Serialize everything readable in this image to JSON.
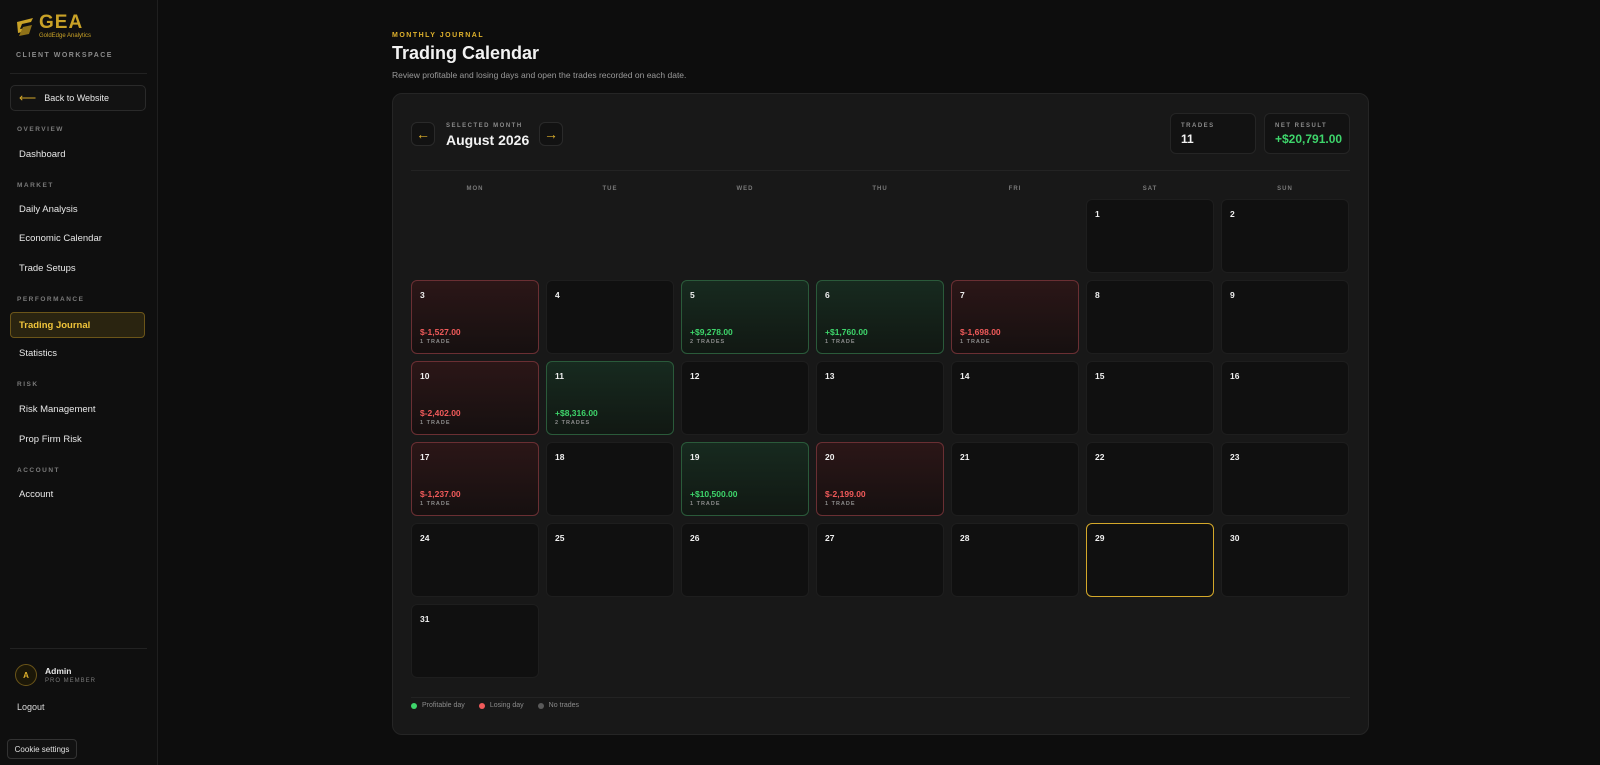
{
  "brand": {
    "name": "GEA",
    "tagline": "GoldEdge Analytics",
    "workspace": "CLIENT WORKSPACE"
  },
  "sidebar": {
    "back_label": "Back to Website",
    "sections": [
      {
        "title": "OVERVIEW",
        "items": [
          "Dashboard"
        ]
      },
      {
        "title": "MARKET",
        "items": [
          "Daily Analysis",
          "Economic Calendar",
          "Trade Setups"
        ]
      },
      {
        "title": "PERFORMANCE",
        "items": [
          "Trading Journal",
          "Statistics"
        ]
      },
      {
        "title": "RISK",
        "items": [
          "Risk Management",
          "Prop Firm Risk"
        ]
      },
      {
        "title": "ACCOUNT",
        "items": [
          "Account"
        ]
      }
    ],
    "active_item": "Trading Journal",
    "user": {
      "initial": "A",
      "name": "Admin",
      "role": "PRO MEMBER"
    },
    "logout_label": "Logout",
    "cookie_label": "Cookie settings"
  },
  "header": {
    "eyebrow": "MONTHLY JOURNAL",
    "title": "Trading Calendar",
    "subtitle": "Review profitable and losing days and open the trades recorded on each date."
  },
  "calendar": {
    "selected_label": "SELECTED MONTH",
    "month": "August 2026",
    "prev_icon": "←",
    "next_icon": "→",
    "stats": {
      "trades_label": "TRADES",
      "trades_value": "11",
      "net_label": "NET RESULT",
      "net_value": "+$20,791.00"
    },
    "weekdays": [
      "MON",
      "TUE",
      "WED",
      "THU",
      "FRI",
      "SAT",
      "SUN"
    ],
    "days": [
      {
        "day": "1",
        "col": 5,
        "row": 0
      },
      {
        "day": "2",
        "col": 6,
        "row": 0
      },
      {
        "day": "3",
        "col": 0,
        "row": 1,
        "status": "loss",
        "pnl": "$-1,527.00",
        "trades": "1 TRADE"
      },
      {
        "day": "4",
        "col": 1,
        "row": 1
      },
      {
        "day": "5",
        "col": 2,
        "row": 1,
        "status": "win",
        "pnl": "+$9,278.00",
        "trades": "2 TRADES"
      },
      {
        "day": "6",
        "col": 3,
        "row": 1,
        "status": "win",
        "pnl": "+$1,760.00",
        "trades": "1 TRADE"
      },
      {
        "day": "7",
        "col": 4,
        "row": 1,
        "status": "loss",
        "pnl": "$-1,698.00",
        "trades": "1 TRADE"
      },
      {
        "day": "8",
        "col": 5,
        "row": 1
      },
      {
        "day": "9",
        "col": 6,
        "row": 1
      },
      {
        "day": "10",
        "col": 0,
        "row": 2,
        "status": "loss",
        "pnl": "$-2,402.00",
        "trades": "1 TRADE"
      },
      {
        "day": "11",
        "col": 1,
        "row": 2,
        "status": "win",
        "pnl": "+$8,316.00",
        "trades": "2 TRADES"
      },
      {
        "day": "12",
        "col": 2,
        "row": 2
      },
      {
        "day": "13",
        "col": 3,
        "row": 2
      },
      {
        "day": "14",
        "col": 4,
        "row": 2
      },
      {
        "day": "15",
        "col": 5,
        "row": 2
      },
      {
        "day": "16",
        "col": 6,
        "row": 2
      },
      {
        "day": "17",
        "col": 0,
        "row": 3,
        "status": "loss",
        "pnl": "$-1,237.00",
        "trades": "1 TRADE"
      },
      {
        "day": "18",
        "col": 1,
        "row": 3
      },
      {
        "day": "19",
        "col": 2,
        "row": 3,
        "status": "win",
        "pnl": "+$10,500.00",
        "trades": "1 TRADE"
      },
      {
        "day": "20",
        "col": 3,
        "row": 3,
        "status": "loss",
        "pnl": "$-2,199.00",
        "trades": "1 TRADE"
      },
      {
        "day": "21",
        "col": 4,
        "row": 3
      },
      {
        "day": "22",
        "col": 5,
        "row": 3
      },
      {
        "day": "23",
        "col": 6,
        "row": 3
      },
      {
        "day": "24",
        "col": 0,
        "row": 4
      },
      {
        "day": "25",
        "col": 1,
        "row": 4
      },
      {
        "day": "26",
        "col": 2,
        "row": 4
      },
      {
        "day": "27",
        "col": 3,
        "row": 4
      },
      {
        "day": "28",
        "col": 4,
        "row": 4
      },
      {
        "day": "29",
        "col": 5,
        "row": 4,
        "today": true
      },
      {
        "day": "30",
        "col": 6,
        "row": 4
      },
      {
        "day": "31",
        "col": 0,
        "row": 5
      }
    ],
    "legend": [
      {
        "label": "Profitable day",
        "color": "#3ed56b"
      },
      {
        "label": "Losing day",
        "color": "#f05a5a"
      },
      {
        "label": "No trades",
        "color": "#5a5a5a"
      }
    ]
  }
}
